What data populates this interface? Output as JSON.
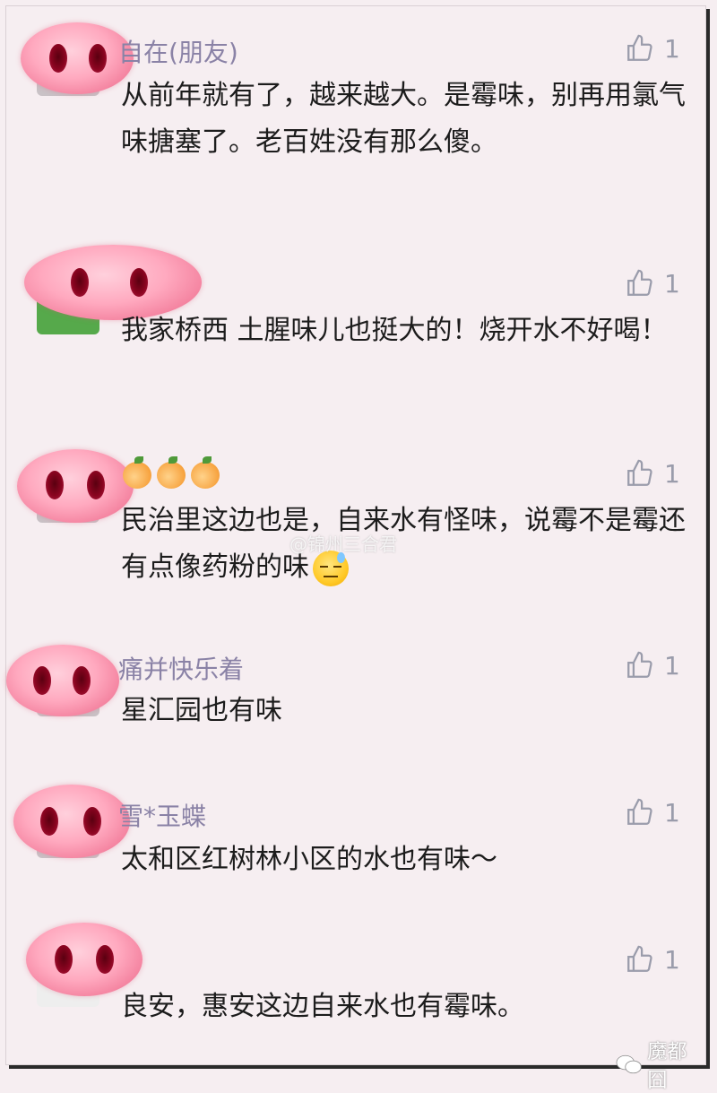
{
  "comments": [
    {
      "name": "自在(朋友)",
      "likes": "1",
      "text": "从前年就有了，越来越大。是霉味，别再用氯气味搪塞了。老百姓没有那么傻。"
    },
    {
      "name": "",
      "likes": "1",
      "text": "我家桥西 土腥味儿也挺大的！烧开水不好喝！"
    },
    {
      "name": "",
      "likes": "1",
      "text": "民治里这边也是，自来水有怪味，说霉不是霉还有点像药粉的味",
      "emoji": "sweat-expressionless-emoji"
    },
    {
      "name": "痛并快乐着",
      "likes": "1",
      "text": "星汇园也有味"
    },
    {
      "name": "雪*玉蝶",
      "likes": "1",
      "text": "太和区红树林小区的水也有味～"
    },
    {
      "name": "",
      "likes": "1",
      "text": "良安，惠安这边自来水也有霉味。"
    }
  ],
  "watermark": "@锦州三合君",
  "logo": "魔都囧",
  "icons": {
    "like": "thumbs-up-icon",
    "censor": "pig-nose-sticker"
  },
  "colors": {
    "background": "#f6eef1",
    "name": "#8a82a6",
    "like": "#9a9cab",
    "sticker": "#ffa9bf"
  }
}
